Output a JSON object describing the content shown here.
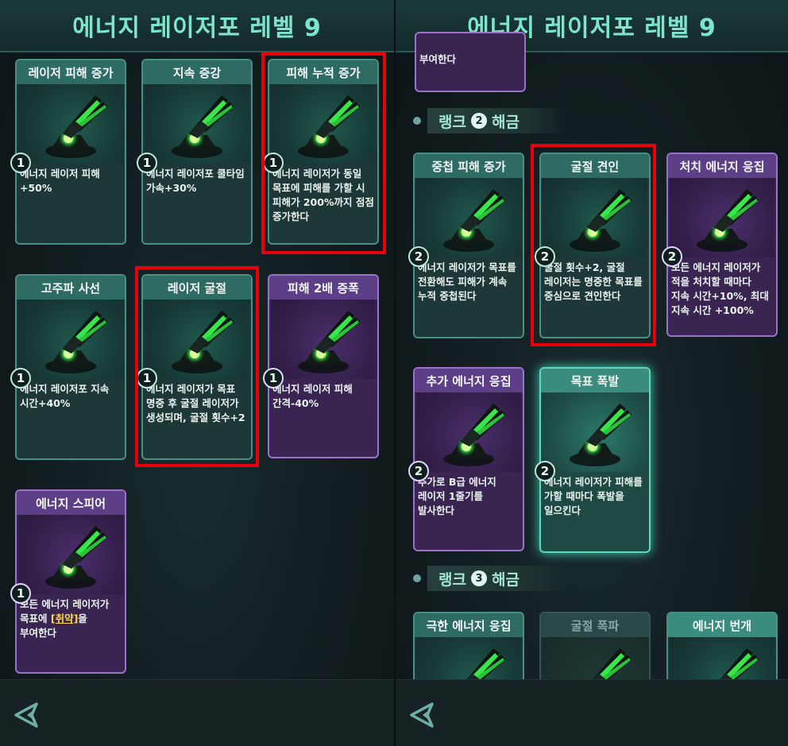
{
  "title": "에너지 레이저포  레벨 9",
  "left": {
    "cards": [
      {
        "title": "레이저 피해 증가",
        "rank": "1",
        "desc": "에너지 레이저 피해 +50%"
      },
      {
        "title": "지속 증강",
        "rank": "1",
        "desc": "에너지 레이저포 쿨타임 가속+30%"
      },
      {
        "title": "피해 누적 증가",
        "rank": "1",
        "desc": "에너지 레이저가 동일 목표에 피해를 가할 시 피해가 200%까지 점점 증가한다"
      },
      {
        "title": "고주파 사선",
        "rank": "1",
        "desc": "에너지 레이저포 지속 시간+40%"
      },
      {
        "title": "레이저 굴절",
        "rank": "1",
        "desc": "에너지 레이저가 목표 명중 후 굴절 레이저가 생성되며, 굴절 횟수+2"
      },
      {
        "title": "피해 2배 증폭",
        "rank": "1",
        "desc": "에너지 레이저 피해 간격-40%"
      },
      {
        "title": "에너지 스피어",
        "rank": "1",
        "desc_pre": "모든 에너지 레이저가 목표에 ",
        "desc_hl": "[취약]",
        "desc_post": "을 부여한다"
      }
    ]
  },
  "right": {
    "top_fragment": "부여한다",
    "rank2": {
      "pre": "랭크",
      "num": "2",
      "post": "해금"
    },
    "rank3": {
      "pre": "랭크",
      "num": "3",
      "post": "해금"
    },
    "cards": [
      {
        "title": "중첩 피해 증가",
        "rank": "2",
        "desc": "에너지 레이저가 목표를 전환해도 피해가 계속 누적 중첩된다"
      },
      {
        "title": "굴절 견인",
        "rank": "2",
        "desc": "굴절 횟수+2, 굴절 레이저는 명중한 목표를 중심으로 견인한다"
      },
      {
        "title": "처치 에너지 응집",
        "rank": "2",
        "desc": "모든 에너지 레이저가 적을 처치할 때마다 지속 시간+10%, 최대 지속 시간 +100%"
      },
      {
        "title": "추가 에너지 응집",
        "rank": "2",
        "desc": "추가로 B급 에너지 레이저 1줄기를 발사한다"
      },
      {
        "title": "목표 폭발",
        "rank": "2",
        "desc": "에너지 레이저가 피해를 가할 때마다 폭발을 일으킨다"
      },
      {
        "title": "극한 에너지 응집"
      },
      {
        "title": "굴절 폭파"
      },
      {
        "title": "에너지 번개"
      }
    ]
  },
  "colors": {
    "accent": "#7ee6c8",
    "teal_card": "#2e6b62",
    "purple_card": "#5c3f86",
    "highlight_box": "#e8000b"
  },
  "icons": {
    "back": "back-arrow-icon",
    "art": "energy-laser-cannon-icon"
  }
}
